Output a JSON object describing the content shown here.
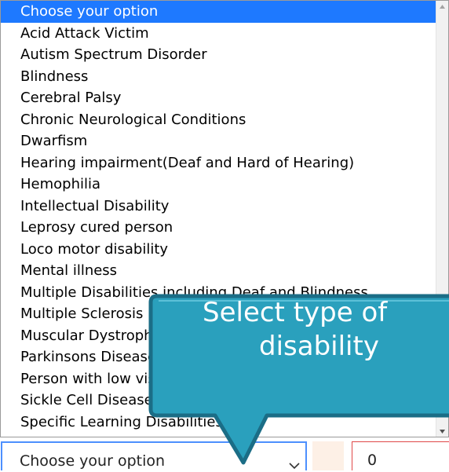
{
  "dropdown": {
    "options": [
      {
        "label": "Choose your option",
        "selected": true
      },
      {
        "label": "Acid Attack Victim"
      },
      {
        "label": "Autism Spectrum Disorder"
      },
      {
        "label": "Blindness"
      },
      {
        "label": "Cerebral Palsy"
      },
      {
        "label": "Chronic Neurological Conditions"
      },
      {
        "label": "Dwarfism"
      },
      {
        "label": "Hearing impairment(Deaf and Hard of Hearing)"
      },
      {
        "label": "Hemophilia"
      },
      {
        "label": "Intellectual Disability"
      },
      {
        "label": "Leprosy cured person"
      },
      {
        "label": "Loco motor disability"
      },
      {
        "label": "Mental illness"
      },
      {
        "label": "Multiple Disabilities including Deaf and Blindness"
      },
      {
        "label": "Multiple Sclerosis"
      },
      {
        "label": "Muscular Dystrophy"
      },
      {
        "label": "Parkinsons Disease"
      },
      {
        "label": "Person with low vision"
      },
      {
        "label": "Sickle Cell Disease"
      },
      {
        "label": "Specific Learning Disabilities"
      }
    ]
  },
  "select": {
    "value": "Choose your option"
  },
  "number_input": {
    "value": "0"
  },
  "callout": {
    "line1": "Select type of",
    "line2": "disability"
  },
  "colors": {
    "highlight": "#1e79ff",
    "callout": "#2aa0bd",
    "callout_border": "#1b6d86"
  }
}
